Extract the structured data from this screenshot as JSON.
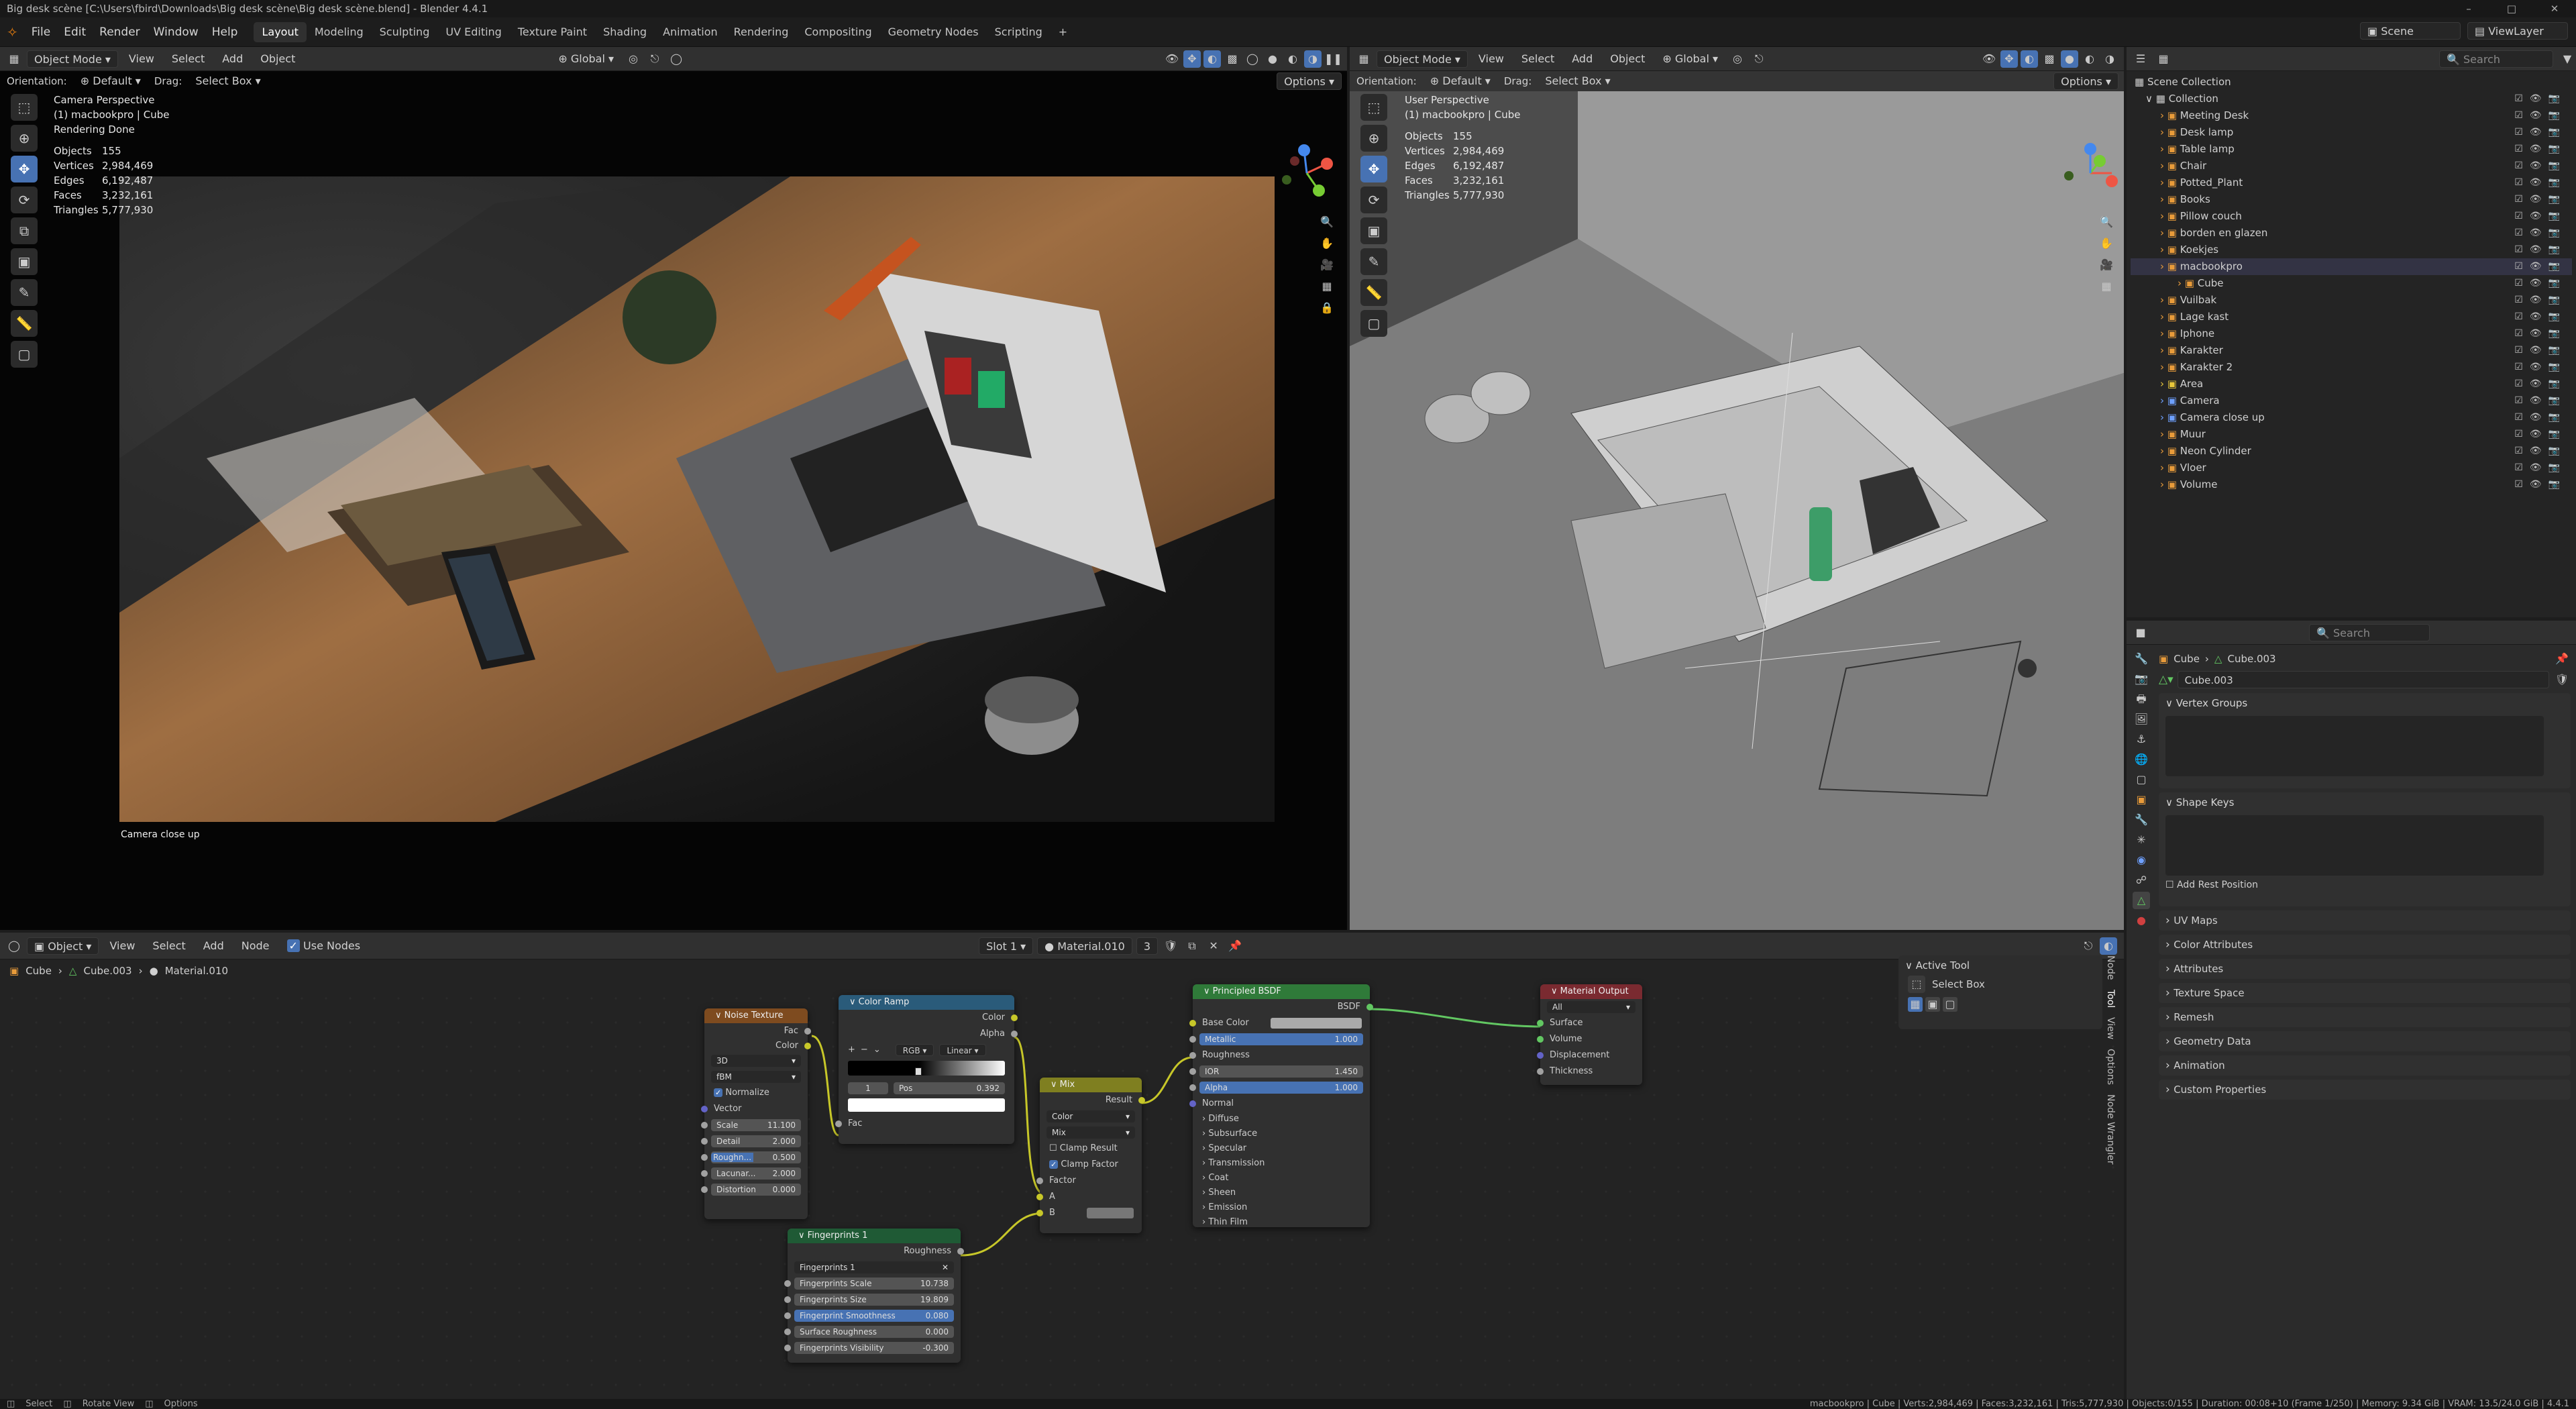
{
  "window": {
    "title": "Big desk scène [C:\\Users\\fbird\\Downloads\\Big desk scène\\Big desk scène.blend] - Blender 4.4.1"
  },
  "menu": {
    "items": [
      "File",
      "Edit",
      "Render",
      "Window",
      "Help"
    ]
  },
  "workspaces": [
    "Layout",
    "Modeling",
    "Sculpting",
    "UV Editing",
    "Texture Paint",
    "Shading",
    "Animation",
    "Rendering",
    "Compositing",
    "Geometry Nodes",
    "Scripting"
  ],
  "topright": {
    "scene": "Scene",
    "viewlayer": "ViewLayer"
  },
  "vp1": {
    "mode": "Object Mode",
    "menus": [
      "View",
      "Select",
      "Add",
      "Object"
    ],
    "transform": "Global",
    "orientation_label": "Orientation:",
    "orientation": "Default",
    "drag_label": "Drag:",
    "drag": "Select Box",
    "options": "Options",
    "overlay": {
      "l1": "Camera Perspective",
      "l2": "(1) macbookpro | Cube",
      "l3": "Rendering Done"
    },
    "stats": [
      [
        "Objects",
        "155"
      ],
      [
        "Vertices",
        "2,984,469"
      ],
      [
        "Edges",
        "6,192,487"
      ],
      [
        "Faces",
        "3,232,161"
      ],
      [
        "Triangles",
        "5,777,930"
      ]
    ],
    "camera_name": "Camera close up"
  },
  "vp2": {
    "mode": "Object Mode",
    "menus": [
      "View",
      "Select",
      "Add",
      "Object"
    ],
    "transform": "Global",
    "orientation_label": "Orientation:",
    "orientation": "Default",
    "drag_label": "Drag:",
    "drag": "Select Box",
    "options": "Options",
    "overlay": {
      "l1": "User Perspective",
      "l2": "(1) macbookpro | Cube"
    },
    "stats": [
      [
        "Objects",
        "155"
      ],
      [
        "Vertices",
        "2,984,469"
      ],
      [
        "Edges",
        "6,192,487"
      ],
      [
        "Faces",
        "3,232,161"
      ],
      [
        "Triangles",
        "5,777,930"
      ]
    ]
  },
  "outliner": {
    "search": "Search",
    "root": "Scene Collection",
    "collection": "Collection",
    "items": [
      "Meeting Desk",
      "Desk lamp",
      "Table lamp",
      "Chair",
      "Potted_Plant",
      "Books",
      "Pillow couch",
      "borden en glazen",
      "Koekjes",
      "macbookpro",
      "Cube",
      "Vuilbak",
      "Lage kast",
      "Iphone",
      "Karakter",
      "Karakter 2",
      "Area",
      "Camera",
      "Camera close up",
      "Muur",
      "Neon Cylinder",
      "Vloer",
      "Volume"
    ]
  },
  "props": {
    "search": "Search",
    "breadcrumb": [
      "Cube",
      "Cube.003"
    ],
    "mesh_name": "Cube.003",
    "panels": {
      "vertex_groups": "Vertex Groups",
      "shape_keys": "Shape Keys",
      "add_rest": "Add Rest Position"
    },
    "collapsed": [
      "UV Maps",
      "Color Attributes",
      "Attributes",
      "Texture Space",
      "Remesh",
      "Geometry Data",
      "Animation",
      "Custom Properties"
    ]
  },
  "nodeeditor": {
    "mode": "Object",
    "menus": [
      "View",
      "Select",
      "Add",
      "Node"
    ],
    "use_nodes": "Use Nodes",
    "slot": "Slot 1",
    "material": "Material.010",
    "users": "3",
    "breadcrumb": [
      "Cube",
      "Cube.003",
      "Material.010"
    ],
    "active_tool": {
      "title": "Active Tool",
      "tool": "Select Box"
    },
    "sidetabs": [
      "Node",
      "Tool",
      "View",
      "Options",
      "Node Wrangler"
    ],
    "noise": {
      "title": "Noise Texture",
      "out1": "Fac",
      "out2": "Color",
      "dim": "3D",
      "type": "fBM",
      "normalize": "Normalize",
      "vector": "Vector",
      "scale_l": "Scale",
      "scale": "11.100",
      "detail_l": "Detail",
      "detail": "2.000",
      "rough_l": "Roughn...",
      "rough": "0.500",
      "lac_l": "Lacunar...",
      "lac": "2.000",
      "dist_l": "Distortion",
      "dist": "0.000"
    },
    "ramp": {
      "title": "Color Ramp",
      "out1": "Color",
      "out2": "Alpha",
      "mode": "RGB",
      "interp": "Linear",
      "index": "1",
      "pos_l": "Pos",
      "pos": "0.392",
      "in": "Fac",
      "stop_level": 0.45
    },
    "mix": {
      "title": "Mix",
      "out": "Result",
      "type": "Color",
      "blend": "Mix",
      "clamp_result": "Clamp Result",
      "clamp_factor": "Clamp Factor",
      "factor": "Factor",
      "a": "A",
      "b": "B"
    },
    "bsdf": {
      "title": "Principled BSDF",
      "out": "BSDF",
      "base": "Base Color",
      "metallic_l": "Metallic",
      "metallic": "1.000",
      "rough": "Roughness",
      "ior_l": "IOR",
      "ior": "1.450",
      "alpha_l": "Alpha",
      "alpha": "1.000",
      "normal": "Normal",
      "subs": [
        "Diffuse",
        "Subsurface",
        "Specular",
        "Transmission",
        "Coat",
        "Sheen",
        "Emission",
        "Thin Film"
      ]
    },
    "output": {
      "title": "Material Output",
      "target": "All",
      "ins": [
        "Surface",
        "Volume",
        "Displacement",
        "Thickness"
      ]
    },
    "finger": {
      "title": "Fingerprints 1",
      "out": "Roughness",
      "group": "Fingerprints 1",
      "rows": [
        [
          "Fingerprints Scale",
          "10.738"
        ],
        [
          "Fingerprints Size",
          "19.809"
        ],
        [
          "Fingerprint Smoothness",
          "0.080"
        ],
        [
          "Surface Roughness",
          "0.000"
        ],
        [
          "Fingerprints Visibility",
          "-0.300"
        ]
      ]
    }
  },
  "status": {
    "left": [
      "Select",
      "Rotate View",
      "Options"
    ],
    "right": "macbookpro | Cube | Verts:2,984,469 | Faces:3,232,161 | Tris:5,777,930 | Objects:0/155 | Duration: 00:08+10 (Frame 1/250) | Memory: 9.34 GiB | VRAM: 13.5/24.0 GiB | 4.4.1"
  }
}
